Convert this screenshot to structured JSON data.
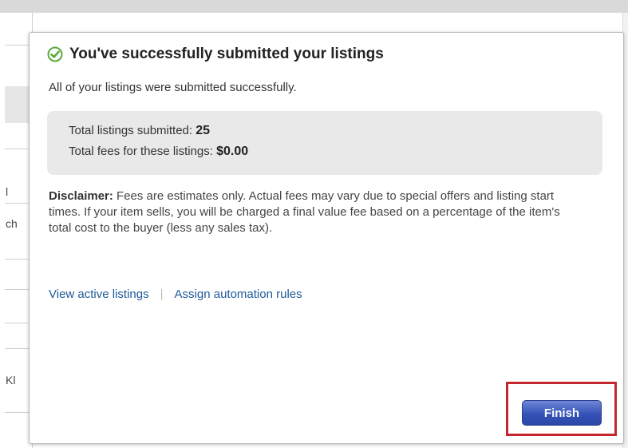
{
  "background_table": {
    "cell_fragments": [
      "l",
      "ch",
      "Kl"
    ]
  },
  "dialog": {
    "title": "You've successfully submitted your listings",
    "subtitle": "All of your listings were submitted successfully.",
    "summary": {
      "listings_label": "Total listings submitted: ",
      "listings_value": "25",
      "fees_label": "Total fees for these listings: ",
      "fees_value": "$0.00"
    },
    "disclaimer_label": "Disclaimer:",
    "disclaimer_text": " Fees are estimates only. Actual fees may vary due to special offers and listing start times. If your item sells, you will be charged a final value fee based on a percentage of the item's total cost to the buyer (less any sales tax).",
    "links": {
      "view_active": "View active listings",
      "separator": "|",
      "assign_rules": "Assign automation rules"
    },
    "finish_label": "Finish"
  },
  "colors": {
    "success_green": "#5aa83a",
    "link_blue": "#1f5a99",
    "button_blue": "#3552b7",
    "highlight_red": "#c4262e"
  },
  "icons": {
    "status": "check-circle-icon"
  }
}
